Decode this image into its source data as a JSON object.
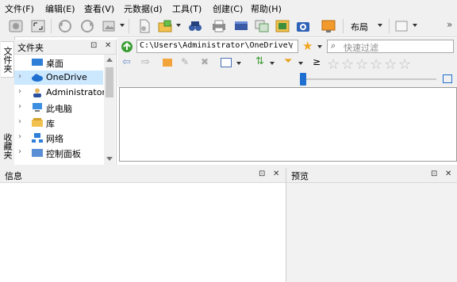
{
  "menu": [
    "文件(F)",
    "编辑(E)",
    "查看(V)",
    "元数据(d)",
    "工具(T)",
    "创建(C)",
    "帮助(H)"
  ],
  "toolbar": {
    "layout_label": "布局",
    "overflow": "»"
  },
  "side_tabs": {
    "folders": "文件夹",
    "favorites": "收藏夹",
    "more": "…"
  },
  "folder_panel": {
    "title": "文件夹",
    "pin": "⊡",
    "close": "✕"
  },
  "tree": [
    {
      "label": "桌面",
      "chevron": "",
      "icon": "desktop"
    },
    {
      "label": "OneDrive",
      "chevron": "›",
      "icon": "cloud"
    },
    {
      "label": "Administrator",
      "chevron": "›",
      "icon": "user"
    },
    {
      "label": "此电脑",
      "chevron": "›",
      "icon": "computer"
    },
    {
      "label": "库",
      "chevron": "›",
      "icon": "library"
    },
    {
      "label": "网络",
      "chevron": "›",
      "icon": "network"
    },
    {
      "label": "控制面板",
      "chevron": "›",
      "icon": "control-panel"
    }
  ],
  "address": {
    "path": "C:\\Users\\Administrator\\OneDrive\\",
    "dropdown": "∨"
  },
  "search": {
    "placeholder": "快速过滤"
  },
  "filter_ops": {
    "ge": "≥"
  },
  "rating": {
    "stars": [
      "☆",
      "☆",
      "☆",
      "☆",
      "☆",
      "☆"
    ]
  },
  "info_panel": {
    "title": "信息",
    "pin": "⊡",
    "close": "✕"
  },
  "preview_panel": {
    "title": "预览",
    "pin": "⊡",
    "close": "✕"
  },
  "colors": {
    "accent": "#1e6fd0",
    "selection": "#cce8ff",
    "star": "#bdbdbd",
    "folder": "#f2c14e"
  }
}
